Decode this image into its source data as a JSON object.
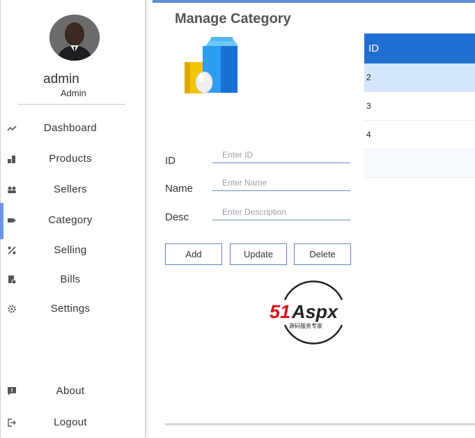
{
  "user": {
    "name": "admin",
    "role": "Admin"
  },
  "sidebar": {
    "items": [
      {
        "label": "Dashboard",
        "icon": "trend-icon"
      },
      {
        "label": "Products",
        "icon": "products-icon"
      },
      {
        "label": "Sellers",
        "icon": "users-icon"
      },
      {
        "label": "Category",
        "icon": "tag-icon",
        "active": true
      },
      {
        "label": "Selling",
        "icon": "percent-icon"
      },
      {
        "label": "Bills",
        "icon": "bill-icon"
      },
      {
        "label": "Settings",
        "icon": "gear-icon"
      },
      {
        "label": "About",
        "icon": "info-icon"
      },
      {
        "label": "Logout",
        "icon": "logout-icon"
      }
    ]
  },
  "main": {
    "title": "Manage Category",
    "form": {
      "id_label": "ID",
      "id_placeholder": "Enter ID",
      "name_label": "Name",
      "name_placeholder": "Enter Name",
      "desc_label": "Desc",
      "desc_placeholder": "Enter Description"
    },
    "buttons": {
      "add": "Add",
      "update": "Update",
      "delete": "Delete"
    },
    "logo": {
      "text": "51Aspx",
      "subtitle": "源码服务专家"
    }
  },
  "table": {
    "headers": [
      "ID"
    ],
    "rows": [
      [
        "2"
      ],
      [
        "3"
      ],
      [
        "4"
      ],
      [
        ""
      ]
    ]
  },
  "colors": {
    "accent": "#1f6fd0",
    "topbar": "#5b8fd6",
    "selected_row": "#d4e6fb",
    "active_marker": "#6a94e8"
  }
}
